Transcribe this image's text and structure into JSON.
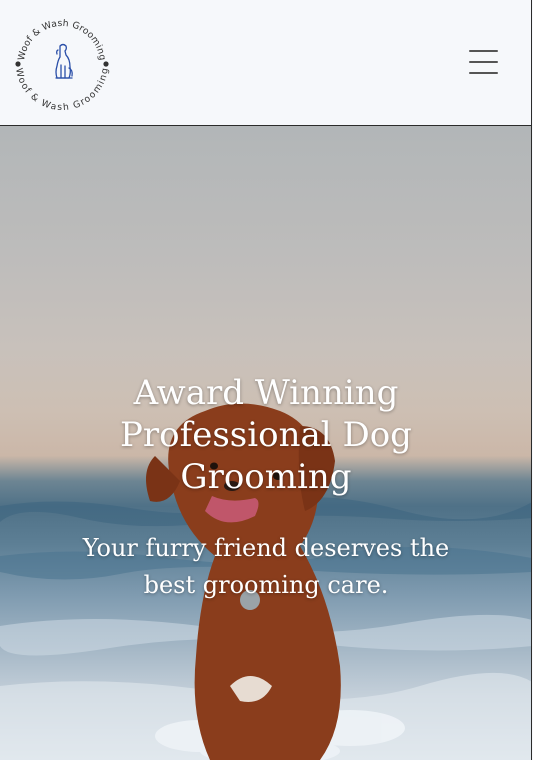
{
  "header": {
    "logo_text_top": "Woof & Wash Grooming",
    "logo_text_bottom": "Woof & Wash Grooming",
    "menu_icon": "hamburger-menu-icon"
  },
  "hero": {
    "title": "Award Winning Professional Dog Grooming",
    "subtitle": "Your furry friend deserves the best grooming care."
  },
  "colors": {
    "header_bg": "#f6f8fb",
    "logo_blue": "#2a4fa8",
    "text_white": "#ffffff"
  }
}
